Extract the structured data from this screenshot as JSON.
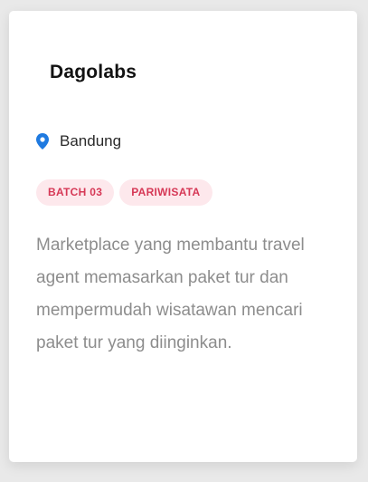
{
  "card": {
    "title": "Dagolabs",
    "location": {
      "icon": "map-pin-icon",
      "icon_color": "#1f7ae0",
      "city": "Bandung"
    },
    "tags": [
      {
        "label": "BATCH 03",
        "text_color": "#d63856",
        "bg_color": "#fde8ec"
      },
      {
        "label": "PARIWISATA",
        "text_color": "#d63856",
        "bg_color": "#fde8ec"
      }
    ],
    "description": "Marketplace yang membantu travel agent memasarkan paket tur dan mempermudah wisatawan mencari paket tur yang diinginkan."
  }
}
